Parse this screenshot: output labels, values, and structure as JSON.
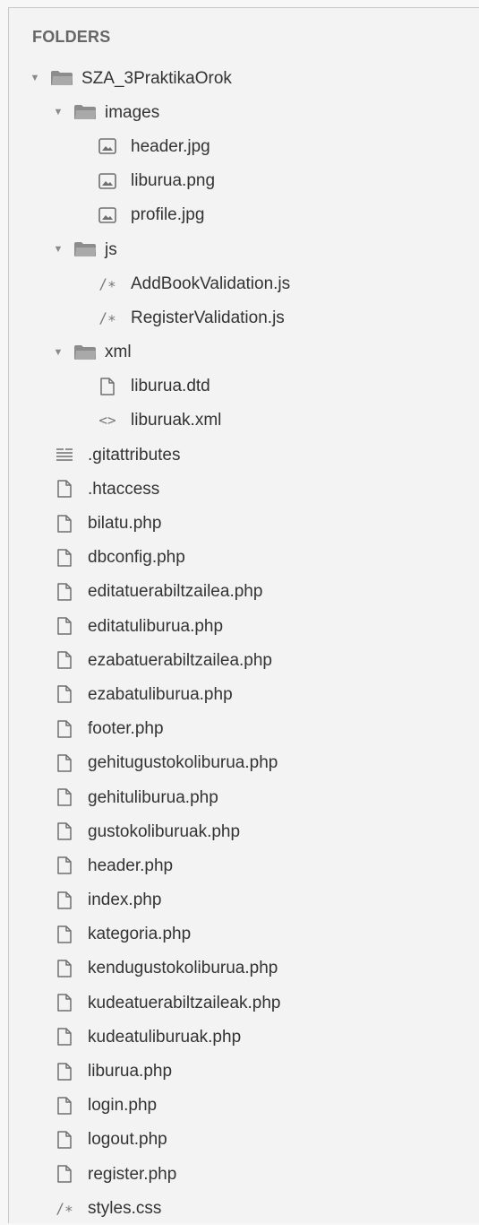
{
  "sidebar": {
    "header": "FOLDERS",
    "items": [
      {
        "label": "SZA_3PraktikaOrok",
        "type": "folder",
        "depth": 0,
        "icon": "folder-open-icon",
        "name": "folder-sza-3praktikaorok"
      },
      {
        "label": "images",
        "type": "folder",
        "depth": 1,
        "icon": "folder-open-icon",
        "name": "folder-images"
      },
      {
        "label": "header.jpg",
        "type": "image",
        "depth": 2,
        "icon": "image-file-icon",
        "name": "file-header-jpg"
      },
      {
        "label": "liburua.png",
        "type": "image",
        "depth": 2,
        "icon": "image-file-icon",
        "name": "file-liburua-png"
      },
      {
        "label": "profile.jpg",
        "type": "image",
        "depth": 2,
        "icon": "image-file-icon",
        "name": "file-profile-jpg"
      },
      {
        "label": "js",
        "type": "folder",
        "depth": 1,
        "icon": "folder-open-icon",
        "name": "folder-js"
      },
      {
        "label": "AddBookValidation.js",
        "type": "code",
        "depth": 2,
        "icon": "comment-code-icon",
        "name": "file-addbookvalidation-js"
      },
      {
        "label": "RegisterValidation.js",
        "type": "code",
        "depth": 2,
        "icon": "comment-code-icon",
        "name": "file-registervalidation-js"
      },
      {
        "label": "xml",
        "type": "folder",
        "depth": 1,
        "icon": "folder-open-icon",
        "name": "folder-xml"
      },
      {
        "label": "liburua.dtd",
        "type": "file",
        "depth": 2,
        "icon": "file-icon",
        "name": "file-liburua-dtd"
      },
      {
        "label": "liburuak.xml",
        "type": "markup",
        "depth": 2,
        "icon": "angle-brackets-icon",
        "name": "file-liburuak-xml"
      },
      {
        "label": ".gitattributes",
        "type": "lines",
        "depth": 1,
        "icon": "text-lines-icon",
        "name": "file-gitattributes"
      },
      {
        "label": ".htaccess",
        "type": "file",
        "depth": 1,
        "icon": "file-icon",
        "name": "file-htaccess"
      },
      {
        "label": "bilatu.php",
        "type": "file",
        "depth": 1,
        "icon": "file-icon",
        "name": "file-bilatu-php"
      },
      {
        "label": "dbconfig.php",
        "type": "file",
        "depth": 1,
        "icon": "file-icon",
        "name": "file-dbconfig-php"
      },
      {
        "label": "editatuerabiltzailea.php",
        "type": "file",
        "depth": 1,
        "icon": "file-icon",
        "name": "file-editatuerabiltzailea-php"
      },
      {
        "label": "editatuliburua.php",
        "type": "file",
        "depth": 1,
        "icon": "file-icon",
        "name": "file-editatuliburua-php"
      },
      {
        "label": "ezabatuerabiltzailea.php",
        "type": "file",
        "depth": 1,
        "icon": "file-icon",
        "name": "file-ezabatuerabiltzailea-php"
      },
      {
        "label": "ezabatuliburua.php",
        "type": "file",
        "depth": 1,
        "icon": "file-icon",
        "name": "file-ezabatuliburua-php"
      },
      {
        "label": "footer.php",
        "type": "file",
        "depth": 1,
        "icon": "file-icon",
        "name": "file-footer-php"
      },
      {
        "label": "gehitugustokoliburua.php",
        "type": "file",
        "depth": 1,
        "icon": "file-icon",
        "name": "file-gehitugustokoliburua-php"
      },
      {
        "label": "gehituliburua.php",
        "type": "file",
        "depth": 1,
        "icon": "file-icon",
        "name": "file-gehituliburua-php"
      },
      {
        "label": "gustokoliburuak.php",
        "type": "file",
        "depth": 1,
        "icon": "file-icon",
        "name": "file-gustokoliburuak-php"
      },
      {
        "label": "header.php",
        "type": "file",
        "depth": 1,
        "icon": "file-icon",
        "name": "file-header-php"
      },
      {
        "label": "index.php",
        "type": "file",
        "depth": 1,
        "icon": "file-icon",
        "name": "file-index-php"
      },
      {
        "label": "kategoria.php",
        "type": "file",
        "depth": 1,
        "icon": "file-icon",
        "name": "file-kategoria-php"
      },
      {
        "label": "kendugustokoliburua.php",
        "type": "file",
        "depth": 1,
        "icon": "file-icon",
        "name": "file-kendugustokoliburua-php"
      },
      {
        "label": "kudeatuerabiltzaileak.php",
        "type": "file",
        "depth": 1,
        "icon": "file-icon",
        "name": "file-kudeatuerabiltzaileak-php"
      },
      {
        "label": "kudeatuliburuak.php",
        "type": "file",
        "depth": 1,
        "icon": "file-icon",
        "name": "file-kudeatuliburuak-php"
      },
      {
        "label": "liburua.php",
        "type": "file",
        "depth": 1,
        "icon": "file-icon",
        "name": "file-liburua-php"
      },
      {
        "label": "login.php",
        "type": "file",
        "depth": 1,
        "icon": "file-icon",
        "name": "file-login-php"
      },
      {
        "label": "logout.php",
        "type": "file",
        "depth": 1,
        "icon": "file-icon",
        "name": "file-logout-php"
      },
      {
        "label": "register.php",
        "type": "file",
        "depth": 1,
        "icon": "file-icon",
        "name": "file-register-php"
      },
      {
        "label": "styles.css",
        "type": "code",
        "depth": 1,
        "icon": "comment-code-icon",
        "name": "file-styles-css"
      }
    ]
  },
  "glyphs": {
    "expanded_arrow": "▼",
    "comment_code": "/∗",
    "angle_brackets": "<>"
  },
  "colors": {
    "background": "#f3f3f3",
    "text": "#333333",
    "header": "#666666",
    "icon": "#7a7a7a"
  }
}
